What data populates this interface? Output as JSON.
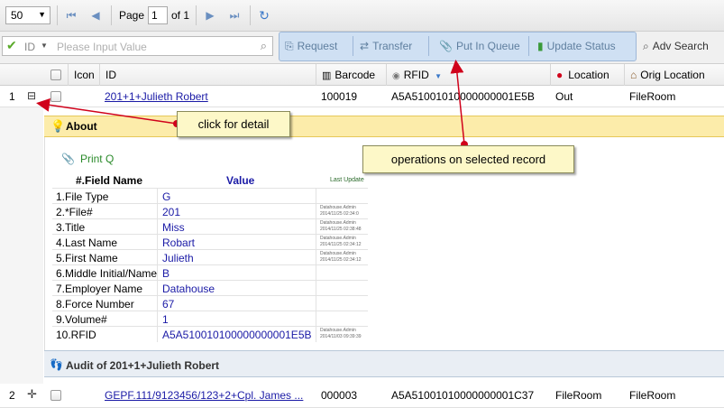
{
  "pager": {
    "page_size": "50",
    "page_label": "Page",
    "page_number": "1",
    "of_label": "of 1"
  },
  "filter": {
    "field": "ID",
    "placeholder": "Please Input Value"
  },
  "operations": {
    "request": "Request",
    "transfer": "Transfer",
    "put_in_queue": "Put In Queue",
    "update_status": "Update Status",
    "adv_search": "Adv Search"
  },
  "grid": {
    "columns": {
      "icon": "Icon",
      "id": "ID",
      "barcode": "Barcode",
      "rfid": "RFID",
      "location": "Location",
      "orig_location": "Orig Location"
    },
    "rows": [
      {
        "num": "1",
        "id": "201+1+Julieth Robert",
        "barcode": "100019",
        "rfid": "A5A51001010000000001E5B",
        "location": "Out",
        "orig_location": "FileRoom"
      },
      {
        "num": "2",
        "id": "GEPF.111/9123456/123+2+Cpl. James ...",
        "barcode": "000003",
        "rfid": "A5A51001010000000001C37",
        "location": "FileRoom",
        "orig_location": "FileRoom"
      }
    ]
  },
  "detail": {
    "about_title": "About",
    "print_q": "Print Q",
    "header_field": "#.Field Name",
    "header_value": "Value",
    "header_update": "Last Update",
    "fields": [
      {
        "name": "1.File Type",
        "value": "G",
        "update1": "",
        "update2": ""
      },
      {
        "name": "2.*File#",
        "value": "201",
        "update1": "Datahouse.Admin",
        "update2": "2014/11/25 02:34:0"
      },
      {
        "name": "3.Title",
        "value": "Miss",
        "update1": "Datahouse.Admin",
        "update2": "2014/11/25 02:38:48"
      },
      {
        "name": "4.Last Name",
        "value": "Robart",
        "update1": "Datahouse.Admin",
        "update2": "2014/11/25 02:34:12"
      },
      {
        "name": "5.First Name",
        "value": "Julieth",
        "update1": "Datahouse.Admin",
        "update2": "2014/11/25 02:34:12"
      },
      {
        "name": "6.Middle Initial/Name",
        "value": "B",
        "update1": "",
        "update2": ""
      },
      {
        "name": "7.Employer Name",
        "value": "Datahouse",
        "update1": "",
        "update2": ""
      },
      {
        "name": "8.Force Number",
        "value": "67",
        "update1": "",
        "update2": ""
      },
      {
        "name": "9.Volume#",
        "value": "1",
        "update1": "",
        "update2": ""
      },
      {
        "name": "10.RFID",
        "value": "A5A510010100000000001E5B",
        "update1": "Datahouse.Admin",
        "update2": "2014/11/03 09:39:39"
      }
    ],
    "audit_title": "Audit of 201+1+Julieth Robert"
  },
  "callouts": {
    "detail": "click for detail",
    "operations": "operations on selected record"
  },
  "colors": {
    "arrow": "#d0021b",
    "about_bg": "#fcecaa",
    "ops_bg": "#cfe0f3"
  }
}
